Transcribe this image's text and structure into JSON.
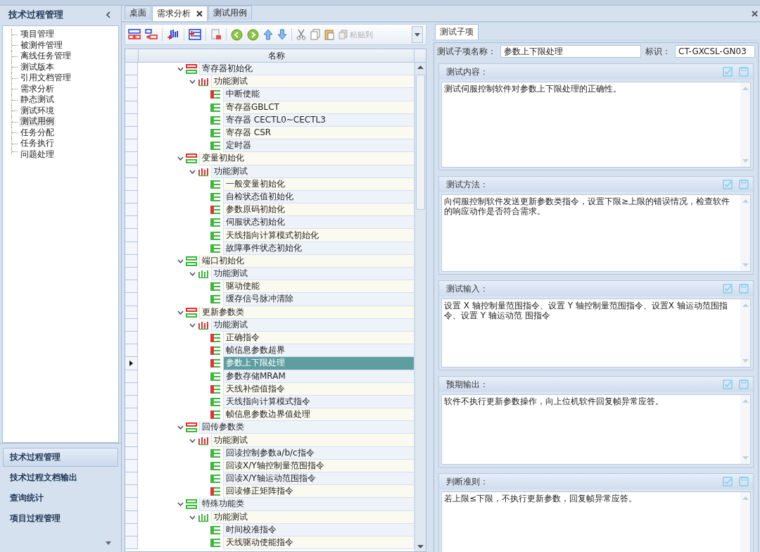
{
  "sidebar": {
    "title": "技术过程管理",
    "items": [
      {
        "label": "项目管理",
        "selected": false
      },
      {
        "label": "被测件管理",
        "selected": false
      },
      {
        "label": "离线任务管理",
        "selected": false
      },
      {
        "label": "测试版本",
        "selected": false
      },
      {
        "label": "引用文档管理",
        "selected": false
      },
      {
        "label": "需求分析",
        "selected": false
      },
      {
        "label": "静态测试",
        "selected": false
      },
      {
        "label": "测试环境",
        "selected": false
      },
      {
        "label": "测试用例",
        "selected": true
      },
      {
        "label": "任务分配",
        "selected": false
      },
      {
        "label": "任务执行",
        "selected": false
      },
      {
        "label": "问题处理",
        "selected": false
      }
    ],
    "nav": [
      {
        "label": "技术过程管理",
        "selected": true
      },
      {
        "label": "技术过程文档输出",
        "selected": false
      },
      {
        "label": "查询统计",
        "selected": false
      },
      {
        "label": "项目过程管理",
        "selected": false
      }
    ]
  },
  "tabs": [
    {
      "label": "桌面",
      "selected": false,
      "closable": false
    },
    {
      "label": "需求分析",
      "selected": true,
      "closable": true
    },
    {
      "label": "测试用例",
      "selected": false,
      "closable": false
    }
  ],
  "toolbar": {
    "paste_to": {
      "label": "粘贴到",
      "disabled": true
    }
  },
  "grid": {
    "column": "名称"
  },
  "tree": [
    {
      "kind": "group",
      "label": "寄存器初始化",
      "color": "#e83030",
      "expanded": true,
      "selected": false,
      "children": [
        {
          "kind": "suite",
          "label": "功能测试",
          "color": "#e83030",
          "expanded": true,
          "selected": false,
          "children": [
            {
              "kind": "case",
              "label": "中断使能",
              "color": "#e83030",
              "selected": false
            },
            {
              "kind": "case",
              "label": "寄存器GBLCT",
              "color": "#3cb83c",
              "selected": false
            },
            {
              "kind": "case",
              "label": "寄存器 CECTL0~CECTL3",
              "color": "#3cb83c",
              "selected": false
            },
            {
              "kind": "case",
              "label": "寄存器 CSR",
              "color": "#3cb83c",
              "selected": false
            },
            {
              "kind": "case",
              "label": "定时器",
              "color": "#3cb83c",
              "selected": false
            }
          ]
        }
      ]
    },
    {
      "kind": "group",
      "label": "变量初始化",
      "color": "#e83030",
      "expanded": true,
      "selected": false,
      "children": [
        {
          "kind": "suite",
          "label": "功能测试",
          "color": "#e83030",
          "expanded": true,
          "selected": false,
          "children": [
            {
              "kind": "case",
              "label": "一般变量初始化",
              "color": "#3cb83c",
              "selected": false
            },
            {
              "kind": "case",
              "label": "自检状态值初始化",
              "color": "#3cb83c",
              "selected": false
            },
            {
              "kind": "case",
              "label": "参数原码初始化",
              "color": "#e83030",
              "selected": false
            },
            {
              "kind": "case",
              "label": "伺服状态初始化",
              "color": "#3cb83c",
              "selected": false
            },
            {
              "kind": "case",
              "label": "天线指向计算模式初始化",
              "color": "#3cb83c",
              "selected": false
            },
            {
              "kind": "case",
              "label": "故障事件状态初始化",
              "color": "#3cb83c",
              "selected": false
            }
          ]
        }
      ]
    },
    {
      "kind": "group",
      "label": "端口初始化",
      "color": "#3cb83c",
      "expanded": true,
      "selected": false,
      "children": [
        {
          "kind": "suite",
          "label": "功能测试",
          "color": "#3cb83c",
          "expanded": true,
          "selected": false,
          "children": [
            {
              "kind": "case",
              "label": "驱动使能",
              "color": "#3cb83c",
              "selected": false
            },
            {
              "kind": "case",
              "label": "缓存信号脉冲清除",
              "color": "#3cb83c",
              "selected": false
            }
          ]
        }
      ]
    },
    {
      "kind": "group",
      "label": "更新参数类",
      "color": "#e83030",
      "expanded": true,
      "selected": false,
      "children": [
        {
          "kind": "suite",
          "label": "功能测试",
          "color": "#e83030",
          "expanded": true,
          "selected": false,
          "children": [
            {
              "kind": "case",
              "label": "正确指令",
              "color": "#e83030",
              "selected": false
            },
            {
              "kind": "case",
              "label": "帧信息参数超界",
              "color": "#e83030",
              "selected": false
            },
            {
              "kind": "case",
              "label": "参数上下限处理",
              "color": "#e83030",
              "selected": true
            },
            {
              "kind": "case",
              "label": "参数存储MRAM",
              "color": "#3cb83c",
              "selected": false
            },
            {
              "kind": "case",
              "label": "天线补偿值指令",
              "color": "#e83030",
              "selected": false
            },
            {
              "kind": "case",
              "label": "天线指向计算模式指令",
              "color": "#3cb83c",
              "selected": false
            },
            {
              "kind": "case",
              "label": "帧信息参数边界值处理",
              "color": "#e83030",
              "selected": false
            }
          ]
        }
      ]
    },
    {
      "kind": "group",
      "label": "回传参数类",
      "color": "#e83030",
      "expanded": true,
      "selected": false,
      "children": [
        {
          "kind": "suite",
          "label": "功能测试",
          "color": "#e83030",
          "expanded": true,
          "selected": false,
          "children": [
            {
              "kind": "case",
              "label": "回读控制参数a/b/c指令",
              "color": "#3cb83c",
              "selected": false
            },
            {
              "kind": "case",
              "label": "回读X/Y轴控制量范围指令",
              "color": "#3cb83c",
              "selected": false
            },
            {
              "kind": "case",
              "label": "回读X/Y轴运动范围指令",
              "color": "#3cb83c",
              "selected": false
            },
            {
              "kind": "case",
              "label": "回读修正矩阵指令",
              "color": "#e83030",
              "selected": false
            }
          ]
        }
      ]
    },
    {
      "kind": "group",
      "label": "特殊功能类",
      "color": "#3cb83c",
      "expanded": true,
      "selected": false,
      "children": [
        {
          "kind": "suite",
          "label": "功能测试",
          "color": "#3cb83c",
          "expanded": true,
          "selected": false,
          "children": [
            {
              "kind": "case",
              "label": "时间校准指令",
              "color": "#3cb83c",
              "selected": false
            },
            {
              "kind": "case",
              "label": "天线驱动使能指令",
              "color": "#3cb83c",
              "selected": false
            }
          ]
        }
      ]
    }
  ],
  "detail": {
    "tab": "测试子项",
    "name_label": "测试子项名称：",
    "name_value": "参数上下限处理",
    "id_label": "标识：",
    "id_value": "CT-GXCSL-GN03",
    "sections": [
      {
        "title": "测试内容：",
        "text": "测试伺服控制软件对参数上下限处理的正确性。"
      },
      {
        "title": "测试方法：",
        "text": "向伺服控制软件发送更新参数类指令，设置下限≥上限的错误情况，检查软件的响应动作是否符合需求。"
      },
      {
        "title": "测试输入：",
        "text": "设置 X 轴控制量范围指令、设置 Y 轴控制量范围指令、设置X 轴运动范围指令、设置 Y 轴运动范 围指令"
      },
      {
        "title": "预期输出：",
        "text": "软件不执行更新参数操作，向上位机软件回复帧异常应答。"
      },
      {
        "title": "判断准则：",
        "text": "若上限≤下限，不执行更新参数，回复帧异常应答。"
      }
    ]
  }
}
